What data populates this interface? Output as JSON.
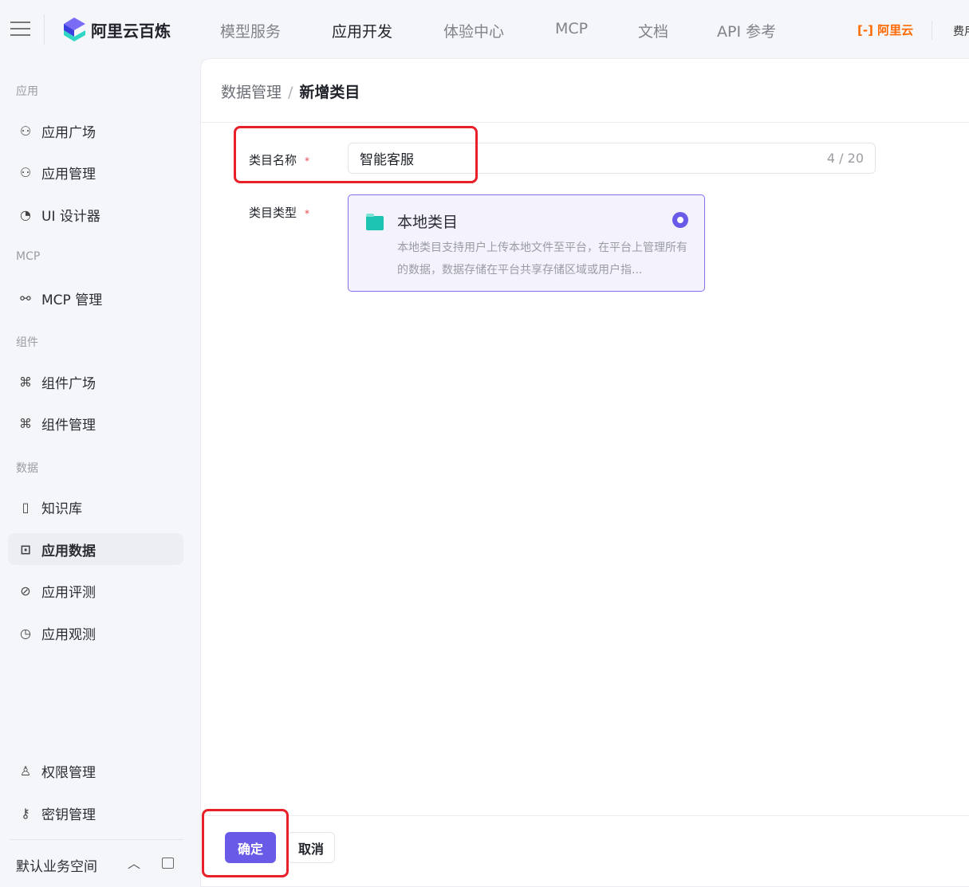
{
  "header": {
    "brand": "阿里云百炼",
    "nav": [
      "模型服务",
      "应用开发",
      "体验中心",
      "MCP",
      "文档",
      "API 参考"
    ],
    "active_nav": "应用开发",
    "aliyun": "阿里云",
    "fee": "费用"
  },
  "sidebar": {
    "sections": [
      {
        "label": "应用"
      },
      {
        "label": "MCP"
      },
      {
        "label": "组件"
      },
      {
        "label": "数据"
      }
    ],
    "items": [
      {
        "label": "应用广场",
        "icon": "grid-icon"
      },
      {
        "label": "应用管理",
        "icon": "grid-icon"
      },
      {
        "label": "UI 设计器",
        "icon": "palette-icon"
      },
      {
        "label": "MCP 管理",
        "icon": "mcp-icon"
      },
      {
        "label": "组件广场",
        "icon": "puzzle-icon"
      },
      {
        "label": "组件管理",
        "icon": "puzzle-gear-icon"
      },
      {
        "label": "知识库",
        "icon": "book-icon"
      },
      {
        "label": "应用数据",
        "icon": "chart-icon"
      },
      {
        "label": "应用评测",
        "icon": "compass-icon"
      },
      {
        "label": "应用观测",
        "icon": "pie-icon"
      }
    ],
    "bottom": [
      {
        "label": "权限管理",
        "icon": "user-icon"
      },
      {
        "label": "密钥管理",
        "icon": "key-icon"
      }
    ],
    "workspace": "默认业务空间"
  },
  "breadcrumb": {
    "parent": "数据管理",
    "sep": "/",
    "current": "新增类目"
  },
  "form": {
    "name_label": "类目名称",
    "required": "*",
    "name_value": "智能客服",
    "name_count": "4 / 20",
    "type_label": "类目类型",
    "card": {
      "title": "本地类目",
      "desc": "本地类目支持用户上传本地文件至平台，在平台上管理所有的数据，数据存储在平台共享存储区域或用户指...",
      "selected": true
    }
  },
  "footer": {
    "ok": "确定",
    "cancel": "取消"
  }
}
